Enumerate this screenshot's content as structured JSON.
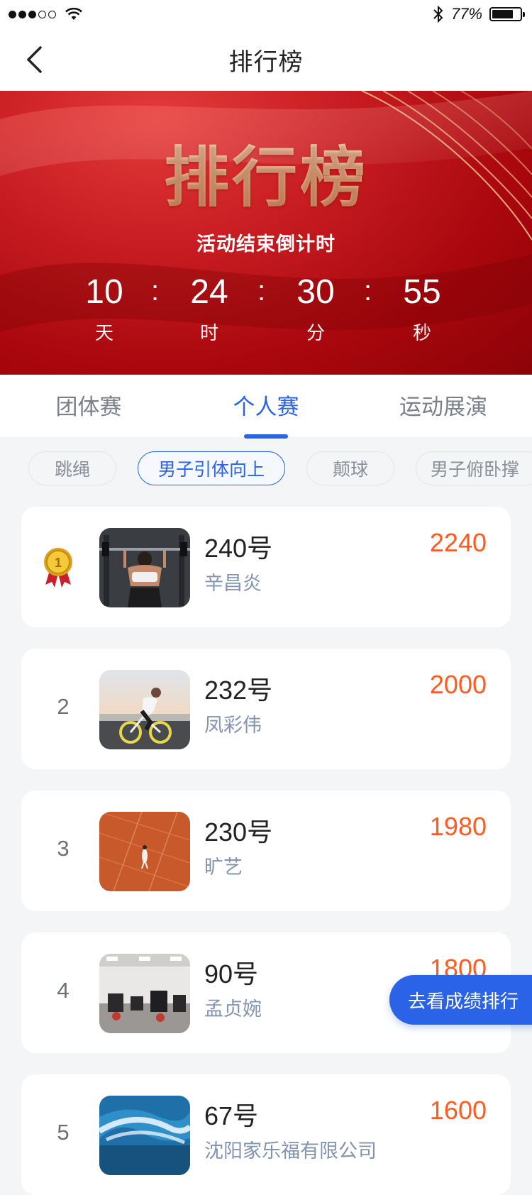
{
  "status_bar": {
    "battery_text": "77%",
    "battery_level": 0.77
  },
  "nav": {
    "title": "排行榜"
  },
  "banner": {
    "title": "排行榜",
    "countdown_label": "活动结束倒计时",
    "timer": [
      {
        "value": "10",
        "unit": "天"
      },
      {
        "value": "24",
        "unit": "时"
      },
      {
        "value": "30",
        "unit": "分"
      },
      {
        "value": "55",
        "unit": "秒"
      }
    ],
    "separator": ":"
  },
  "tabs": [
    {
      "label": "团体赛",
      "active": false
    },
    {
      "label": "个人赛",
      "active": true
    },
    {
      "label": "运动展演",
      "active": false
    }
  ],
  "chips": [
    {
      "label": "跳绳",
      "active": false
    },
    {
      "label": "男子引体向上",
      "active": true
    },
    {
      "label": "颠球",
      "active": false
    },
    {
      "label": "男子俯卧撑",
      "active": false
    }
  ],
  "rankings": [
    {
      "rank": "1",
      "medal": true,
      "code": "240号",
      "name": "辛昌炎",
      "score": "2240",
      "image": "weightlifting-photo"
    },
    {
      "rank": "2",
      "medal": false,
      "code": "232号",
      "name": "凤彩伟",
      "score": "2000",
      "image": "cycling-photo"
    },
    {
      "rank": "3",
      "medal": false,
      "code": "230号",
      "name": "旷艺",
      "score": "1980",
      "image": "tennis-court-photo"
    },
    {
      "rank": "4",
      "medal": false,
      "code": "90号",
      "name": "孟贞婉",
      "score": "1800",
      "image": "gym-photo"
    },
    {
      "rank": "5",
      "medal": false,
      "code": "67号",
      "name": "沈阳家乐福有限公司",
      "score": "1600",
      "image": "surfing-photo"
    }
  ],
  "float_button": {
    "label": "去看成绩排行"
  },
  "colors": {
    "accent": "#2a62e8",
    "score": "#ff5a1f",
    "banner_red": "#c81d22",
    "gold": "#e9b98a"
  }
}
